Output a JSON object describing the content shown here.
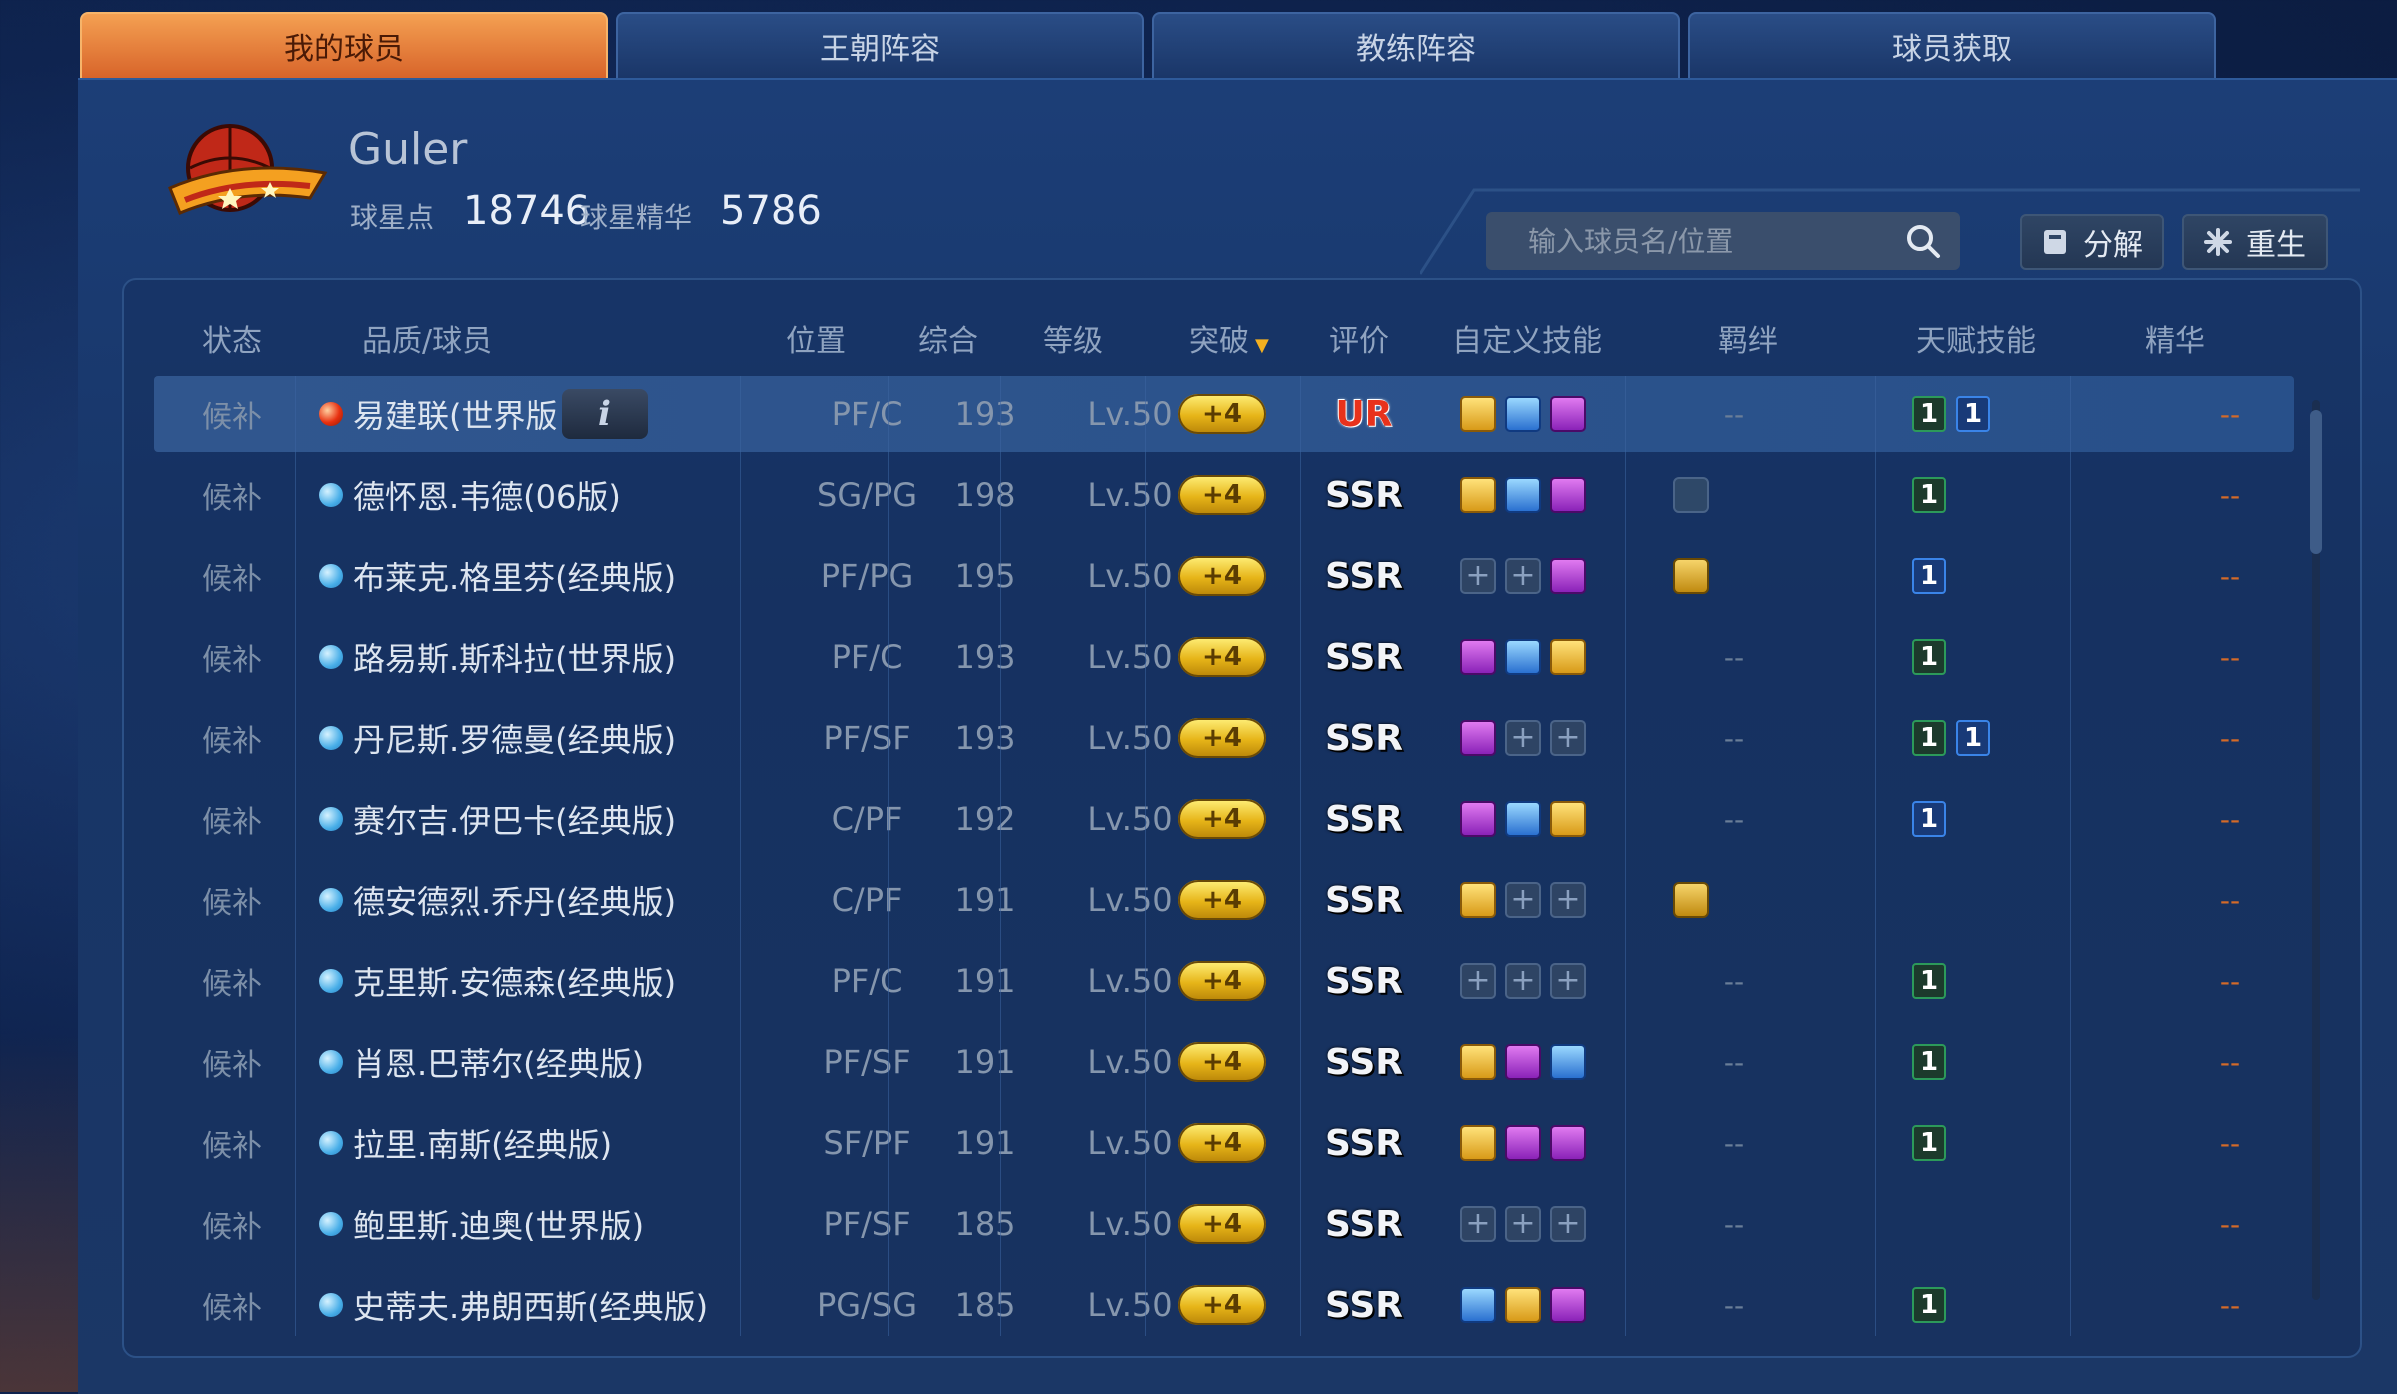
{
  "tabs": [
    {
      "label": "我的球员",
      "active": true
    },
    {
      "label": "王朝阵容",
      "active": false
    },
    {
      "label": "教练阵容",
      "active": false
    },
    {
      "label": "球员获取",
      "active": false
    }
  ],
  "player": {
    "name": "Guler",
    "star_points_label": "球星点",
    "star_points": "18746",
    "essence_label": "球星精华",
    "essence": "5786"
  },
  "search": {
    "placeholder": "输入球员名/位置"
  },
  "buttons": {
    "decompose": "分解",
    "rebirth": "重生"
  },
  "columns": {
    "status": "状态",
    "quality_player": "品质/球员",
    "position": "位置",
    "overall": "综合",
    "level": "等级",
    "breakthrough": "突破",
    "rating": "评价",
    "custom_skills": "自定义技能",
    "bond": "羁绊",
    "talent": "天赋技能",
    "essence": "精华"
  },
  "colors": {
    "active_tab": "#e07030",
    "ur": "#e8321c",
    "ssr": "#ffffff",
    "gold_pill": "#e6b418"
  },
  "rows": [
    {
      "status": "候补",
      "name": "易建联(世界版",
      "quality": "ur",
      "position": "PF/C",
      "overall": "193",
      "level": "Lv.50",
      "breakthrough": "+4",
      "rating": "UR",
      "skills": [
        "gold",
        "blue",
        "purple"
      ],
      "bond": "--",
      "bond_icon": "",
      "talent": [
        "green",
        "blue"
      ],
      "essence": "--",
      "selected": true,
      "info": "i"
    },
    {
      "status": "候补",
      "name": "德怀恩.韦德(06版)",
      "quality": "ssr",
      "position": "SG/PG",
      "overall": "198",
      "level": "Lv.50",
      "breakthrough": "+4",
      "rating": "SSR",
      "skills": [
        "gold",
        "blue",
        "purple"
      ],
      "bond": "",
      "bond_icon": "dark",
      "talent": [
        "green"
      ],
      "essence": "--"
    },
    {
      "status": "候补",
      "name": "布莱克.格里芬(经典版)",
      "quality": "ssr",
      "position": "PF/PG",
      "overall": "195",
      "level": "Lv.50",
      "breakthrough": "+4",
      "rating": "SSR",
      "skills": [
        "empty",
        "empty",
        "purple"
      ],
      "bond": "",
      "bond_icon": "gold",
      "talent": [
        "blue"
      ],
      "essence": "--"
    },
    {
      "status": "候补",
      "name": "路易斯.斯科拉(世界版)",
      "quality": "ssr",
      "position": "PF/C",
      "overall": "193",
      "level": "Lv.50",
      "breakthrough": "+4",
      "rating": "SSR",
      "skills": [
        "purple",
        "blue",
        "gold"
      ],
      "bond": "--",
      "bond_icon": "",
      "talent": [
        "green"
      ],
      "essence": "--"
    },
    {
      "status": "候补",
      "name": "丹尼斯.罗德曼(经典版)",
      "quality": "ssr",
      "position": "PF/SF",
      "overall": "193",
      "level": "Lv.50",
      "breakthrough": "+4",
      "rating": "SSR",
      "skills": [
        "purple",
        "empty",
        "empty"
      ],
      "bond": "--",
      "bond_icon": "",
      "talent": [
        "green",
        "blue"
      ],
      "essence": "--"
    },
    {
      "status": "候补",
      "name": "赛尔吉.伊巴卡(经典版)",
      "quality": "ssr",
      "position": "C/PF",
      "overall": "192",
      "level": "Lv.50",
      "breakthrough": "+4",
      "rating": "SSR",
      "skills": [
        "purple",
        "blue",
        "gold"
      ],
      "bond": "--",
      "bond_icon": "",
      "talent": [
        "blue"
      ],
      "essence": "--"
    },
    {
      "status": "候补",
      "name": "德安德烈.乔丹(经典版)",
      "quality": "ssr",
      "position": "C/PF",
      "overall": "191",
      "level": "Lv.50",
      "breakthrough": "+4",
      "rating": "SSR",
      "skills": [
        "gold",
        "empty",
        "empty"
      ],
      "bond": "",
      "bond_icon": "gold",
      "talent": [],
      "essence": "--"
    },
    {
      "status": "候补",
      "name": "克里斯.安德森(经典版)",
      "quality": "ssr",
      "position": "PF/C",
      "overall": "191",
      "level": "Lv.50",
      "breakthrough": "+4",
      "rating": "SSR",
      "skills": [
        "empty",
        "empty",
        "empty"
      ],
      "bond": "--",
      "bond_icon": "",
      "talent": [
        "green"
      ],
      "essence": "--"
    },
    {
      "status": "候补",
      "name": "肖恩.巴蒂尔(经典版)",
      "quality": "ssr",
      "position": "PF/SF",
      "overall": "191",
      "level": "Lv.50",
      "breakthrough": "+4",
      "rating": "SSR",
      "skills": [
        "gold",
        "purple",
        "blue"
      ],
      "bond": "--",
      "bond_icon": "",
      "talent": [
        "green"
      ],
      "essence": "--"
    },
    {
      "status": "候补",
      "name": "拉里.南斯(经典版)",
      "quality": "ssr",
      "position": "SF/PF",
      "overall": "191",
      "level": "Lv.50",
      "breakthrough": "+4",
      "rating": "SSR",
      "skills": [
        "gold",
        "purple",
        "purple"
      ],
      "bond": "--",
      "bond_icon": "",
      "talent": [
        "green"
      ],
      "essence": "--"
    },
    {
      "status": "候补",
      "name": "鲍里斯.迪奥(世界版)",
      "quality": "ssr",
      "position": "PF/SF",
      "overall": "185",
      "level": "Lv.50",
      "breakthrough": "+4",
      "rating": "SSR",
      "skills": [
        "empty",
        "empty",
        "empty"
      ],
      "bond": "--",
      "bond_icon": "",
      "talent": [],
      "essence": "--"
    },
    {
      "status": "候补",
      "name": "史蒂夫.弗朗西斯(经典版)",
      "quality": "ssr",
      "position": "PG/SG",
      "overall": "185",
      "level": "Lv.50",
      "breakthrough": "+4",
      "rating": "SSR",
      "skills": [
        "blue",
        "gold",
        "purple"
      ],
      "bond": "--",
      "bond_icon": "",
      "talent": [
        "green"
      ],
      "essence": "--"
    }
  ]
}
